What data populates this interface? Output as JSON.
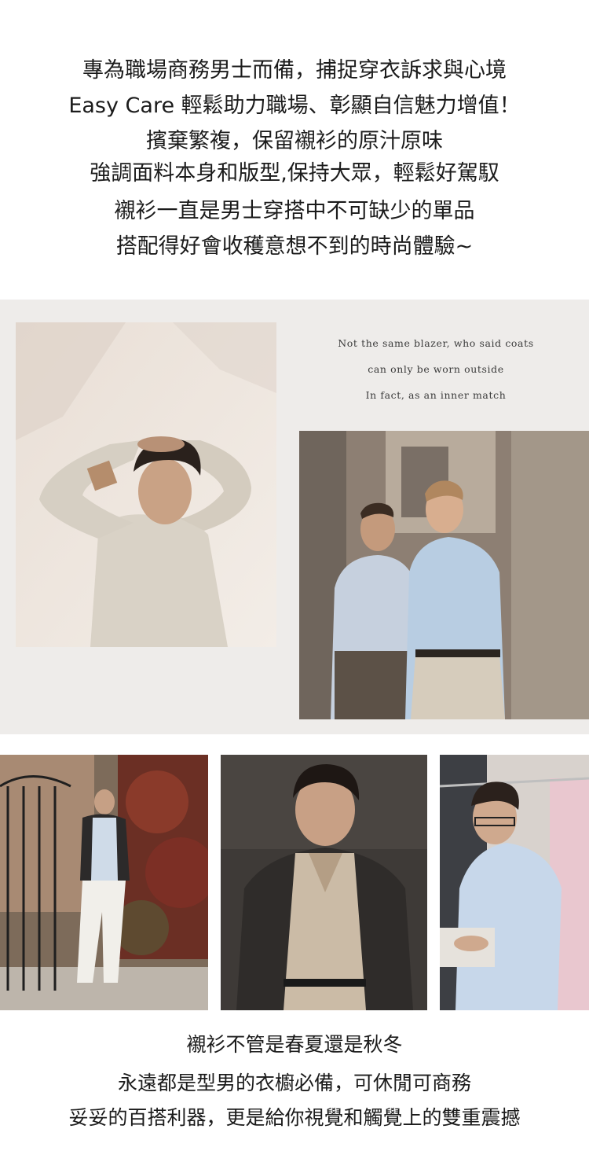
{
  "intro": {
    "lines": [
      "專為職場商務男士而備，捕捉穿衣訴求與心境",
      "Easy Care 輕鬆助力職場、彰顯自信魅力增值！",
      "擯棄繁複，保留襯衫的原汁原味",
      "強調面料本身和版型,保持大眾，輕鬆好駕馭",
      "襯衫一直是男士穿搭中不可缺少的單品",
      "搭配得好會收穫意想不到的時尚體驗~"
    ]
  },
  "quote": {
    "lines": [
      "Not the same blazer, who said coats",
      "can only be worn outside",
      "In fact, as an inner match"
    ]
  },
  "outro": {
    "lines": [
      "襯衫不管是春夏還是秋冬",
      "永遠都是型男的衣櫥必備，可休閒可商務",
      "妥妥的百搭利器，更是給你視覺和觸覺上的雙重震撼"
    ]
  },
  "colors": {
    "text": "#1b1b1b",
    "panel": "#eeecea",
    "quote_text": "#3b3b3b"
  }
}
